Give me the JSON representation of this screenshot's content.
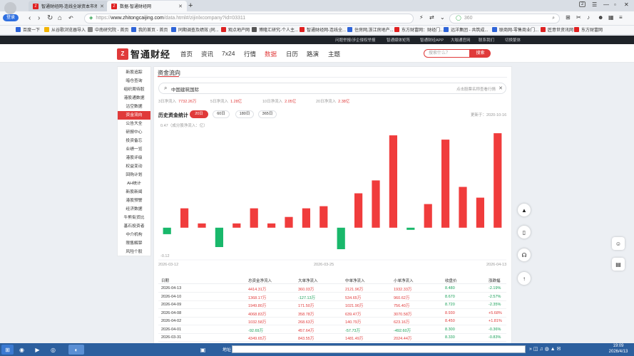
{
  "browser": {
    "login_label": "登录",
    "tabs": [
      {
        "title": "智通财经网-连线全球资本市场",
        "active": false
      },
      {
        "title": "数据-智通财经网",
        "active": true
      }
    ],
    "new_tab": "+",
    "window_controls": {
      "count": "2"
    },
    "url": {
      "scheme": "https://",
      "host": "www.zhitongcaijing.com",
      "path": "/data.html#/zijinlxcompany?id=03311"
    },
    "search_engine": "360",
    "bookmarks": [
      "百度一下",
      "从谷歌浏览器导入",
      "中南研究院 - 首页",
      "我的首页 - 首页",
      "同期调查及绩效 (同...",
      "观点地产网",
      "博隆汇研究-个人主...",
      "智通财经网-连线全...",
      "住房网,浙江房地产...",
      "东方财富网：财经门...",
      "远洋集团 - 共筑成...",
      "联商网-零售商业门...",
      "匠意世资讯网",
      "东方财富网"
    ]
  },
  "site": {
    "strip": [
      "问题举报/涉企侵权举报",
      "智通媒体矩阵",
      "智通财经APP",
      "大咖通官网",
      "联系我们",
      "切换繁体"
    ],
    "logo_mark": "Z",
    "logo_text": "智通财经",
    "nav": [
      {
        "label": "首页",
        "active": false
      },
      {
        "label": "资讯",
        "active": false
      },
      {
        "label": "7x24",
        "active": false
      },
      {
        "label": "行情",
        "active": false
      },
      {
        "label": "数据",
        "active": true
      },
      {
        "label": "日历",
        "active": false
      },
      {
        "label": "路演",
        "active": false
      },
      {
        "label": "主题",
        "active": false
      }
    ],
    "search_placeholder": "搜索什么？",
    "search_button": "搜索"
  },
  "sidebar": {
    "items": [
      "新股追踪",
      "暗仓查询",
      "组织周待股",
      "港股通数据",
      "沽空数据",
      "资金流向",
      "公告大全",
      "研报中心",
      "投资备忘",
      "业绩一览",
      "港股评级",
      "权益变动",
      "回购计划",
      "AH统计",
      "新股新闻",
      "港股预警",
      "经济数据",
      "牛熊街货比",
      "基石投资者",
      "中介机构",
      "限售解禁",
      "风险个股"
    ],
    "active_index": 5
  },
  "main": {
    "title": "资金流向",
    "search": {
      "value": "中国建筑国际",
      "placeholder": "点击股票名称查看行情",
      "clear": "✕"
    },
    "flows": [
      {
        "label": "3日净流入",
        "value": "7732.26万"
      },
      {
        "label": "5日净流入",
        "value": "1.28亿"
      },
      {
        "label": "10日净流入",
        "value": "2.05亿"
      },
      {
        "label": "20日净流入",
        "value": "2.38亿"
      }
    ],
    "history_title": "历史资金统计",
    "ranges": [
      {
        "label": "20日",
        "active": true
      },
      {
        "label": "60日",
        "active": false
      },
      {
        "label": "180日",
        "active": false
      },
      {
        "label": "365日",
        "active": false
      }
    ],
    "updated": "更新于：2020-10-16",
    "unit": "0.47（成分股净流入：亿）"
  },
  "chart_data": {
    "type": "bar",
    "ylabel": "0.47（成分股净流入：亿）",
    "ylim": [
      -0.12,
      0.47
    ],
    "y_ticks": [
      "0.47",
      "-0.12"
    ],
    "x_tick_labels": [
      "2026-03-12",
      "2026-03-25",
      "2026-04-13"
    ],
    "categories": [
      "2026-03-12",
      "2026-03-13",
      "2026-03-16",
      "2026-03-17",
      "2026-03-18",
      "2026-03-19",
      "2026-03-20",
      "2026-03-23",
      "2026-03-24",
      "2026-03-25",
      "2026-03-26",
      "2026-03-27",
      "2026-03-30",
      "2026-03-31",
      "2026-04-01",
      "2026-04-02",
      "2026-04-08",
      "2026-04-09",
      "2026-04-10",
      "2026-04-13"
    ],
    "values": [
      -0.03,
      0.09,
      0.02,
      -0.09,
      0.02,
      0.09,
      0.02,
      0.05,
      0.09,
      0.1,
      -0.1,
      0.16,
      0.22,
      0.43,
      -0.01,
      0.11,
      0.41,
      0.19,
      0.14,
      0.44
    ],
    "colors": {
      "positive": "#f03c3c",
      "negative": "#19b86b"
    }
  },
  "table": {
    "headers": [
      "日期",
      "总资金净流入",
      "大单净流入",
      "中单净流入",
      "小单净流入",
      "收盘价",
      "涨跌幅"
    ],
    "rows": [
      [
        "2026-04-13",
        "4414.31万",
        "360.03万",
        "2121.96万",
        "1932.33万",
        "8.480",
        "-2.19%"
      ],
      [
        "2026-04-10",
        "1368.17万",
        "-127.13万",
        "534.65万",
        "960.62万",
        "8.670",
        "-2.57%"
      ],
      [
        "2026-04-09",
        "1949.80万",
        "171.50万",
        "1021.90万",
        "756.40万",
        "8.720",
        "-2.35%"
      ],
      [
        "2026-04-08",
        "4068.83万",
        "358.78万",
        "639.47万",
        "3070.58万",
        "8.930",
        "+5.68%"
      ],
      [
        "2026-04-02",
        "1032.58万",
        "268.63万",
        "140.79万",
        "623.16万",
        "8.450",
        "+1.81%"
      ],
      [
        "2026-04-01",
        "-92.69万",
        "457.64万",
        "-57.73万",
        "-492.60万",
        "8.300",
        "-0.36%"
      ],
      [
        "2026-03-31",
        "4349.65万",
        "843.55万",
        "1481.49万",
        "2024.44万",
        "8.330",
        "-0.83%"
      ]
    ]
  },
  "taskbar": {
    "address_label": "地址",
    "time": "19:09",
    "date": "2026/4/13"
  }
}
